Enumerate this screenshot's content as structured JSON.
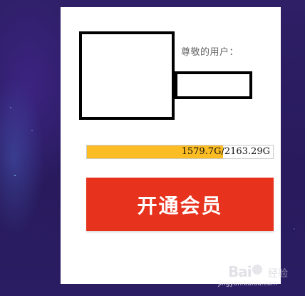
{
  "greeting": "尊敬的用户：",
  "storage": {
    "used": "1579.7G",
    "separator": "/",
    "total": "2163.29G",
    "used_fraction": 0.73
  },
  "vip_button_label": "开通会员",
  "watermark": {
    "logo": "Bai",
    "text": "经验",
    "url": "jingyan.baidu.com"
  },
  "colors": {
    "background": "#2a1a5e",
    "storage_fill": "#fcbd24",
    "button": "#e7331d"
  }
}
